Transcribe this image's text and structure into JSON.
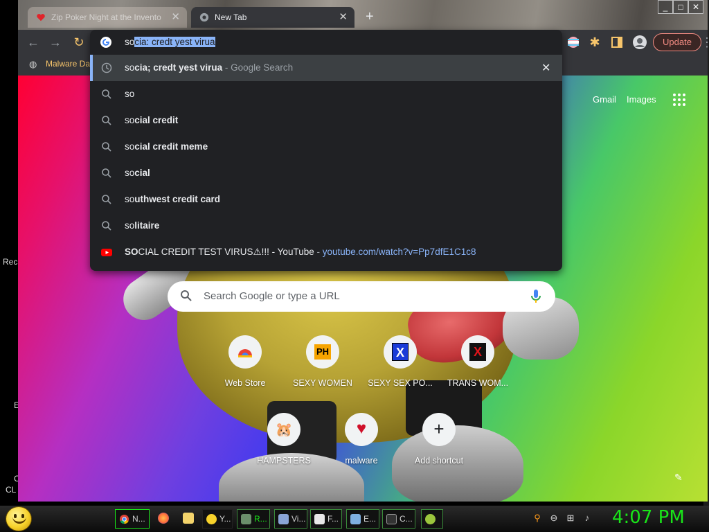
{
  "tabs": [
    {
      "title": "Zip Poker Night at the Invento",
      "active": false
    },
    {
      "title": "New Tab",
      "active": true
    }
  ],
  "window_controls": [
    "_",
    "□",
    "✕"
  ],
  "toolbar": {
    "update_label": "Update"
  },
  "bookmarks": [
    {
      "label": "Malware Da"
    }
  ],
  "omnibox": {
    "typed": "so",
    "autocomplete": "cia: credt yest virua",
    "suggestions": [
      {
        "icon": "history-icon",
        "bold": "so",
        "rest": "cia; credt yest virua",
        "suffix": " - Google Search",
        "selected": true
      },
      {
        "icon": "search-icon",
        "bold": "so",
        "rest": "",
        "suffix": ""
      },
      {
        "icon": "search-icon",
        "bold": "so",
        "rest": "cial credit",
        "suffix": ""
      },
      {
        "icon": "search-icon",
        "bold": "so",
        "rest": "cial credit meme",
        "suffix": ""
      },
      {
        "icon": "search-icon",
        "bold": "so",
        "rest": "cial",
        "suffix": ""
      },
      {
        "icon": "search-icon",
        "bold": "so",
        "rest": "uthwest credit card",
        "suffix": ""
      },
      {
        "icon": "search-icon",
        "bold": "so",
        "rest": "litaire",
        "suffix": ""
      },
      {
        "icon": "youtube-icon",
        "bold": "SO",
        "rest": "CIAL CREDIT TEST VIRUS⚠!!! - YouTube",
        "suffix": " - ",
        "url": "youtube.com/watch?v=Pp7dfE1C1c8"
      }
    ]
  },
  "ntp": {
    "gmail": "Gmail",
    "images": "Images",
    "search_placeholder": "Search Google or type a URL",
    "shortcuts": [
      {
        "label": "Web Store",
        "icon": "chrome-web-store-icon"
      },
      {
        "label": "SEXY WOMEN",
        "icon": "ph-logo-icon",
        "glyph": "PH"
      },
      {
        "label": "SEXY SEX PO...",
        "icon": "x-logo-icon",
        "glyph": "X"
      },
      {
        "label": "TRANS WOM...",
        "icon": "x-red-logo-icon",
        "glyph": "X"
      },
      {
        "label": "HAMPSTERS",
        "icon": "hamster-icon",
        "glyph": "🐹"
      },
      {
        "label": "malware",
        "icon": "heart-icon",
        "glyph": "♥"
      },
      {
        "label": "Add shortcut",
        "icon": "plus-icon",
        "glyph": "+"
      }
    ]
  },
  "desktop": {
    "frag_rec": "Rec",
    "frag_cl": "CL",
    "frag_e": "E",
    "frag_c": "C"
  },
  "taskbar": {
    "tasks": [
      {
        "label": "N...",
        "icon": "chrome-icon"
      },
      {
        "label": "Y...",
        "icon": "smiley-icon"
      },
      {
        "label": "R...",
        "icon": "app-icon"
      },
      {
        "label": "Vi...",
        "icon": "app-icon"
      },
      {
        "label": "F...",
        "icon": "file-icon"
      },
      {
        "label": "E...",
        "icon": "explorer-icon"
      },
      {
        "label": "C...",
        "icon": "cmd-icon"
      }
    ],
    "clock": "4:07 PM"
  },
  "colors": {
    "omnibox_bg": "#202124",
    "accent_blue": "#8ab4f8",
    "update_red": "#f28b82",
    "clock_green": "#19e619"
  }
}
